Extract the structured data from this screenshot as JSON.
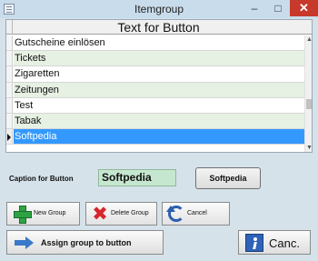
{
  "window": {
    "title": "Itemgroup",
    "minimize_glyph": "–",
    "maximize_glyph": "□",
    "close_glyph": "✕"
  },
  "grid": {
    "column_header": "Text for Button",
    "rows": [
      {
        "text": "Gutscheine einlösen"
      },
      {
        "text": "Tickets"
      },
      {
        "text": "Zigaretten"
      },
      {
        "text": "Zeitungen"
      },
      {
        "text": "Test"
      },
      {
        "text": "Tabak"
      },
      {
        "text": "Softpedia"
      }
    ],
    "selected_row_text": "Softpedia",
    "scroll_up_glyph": "▲",
    "scroll_down_glyph": "▼"
  },
  "caption": {
    "label": "Caption for Button",
    "value": "Softpedia",
    "preview_button_label": "Softpedia"
  },
  "actions": {
    "new_group": "New Group",
    "delete_group": "Delete Group",
    "cancel": "Cancel",
    "assign_group": "Assign group to button",
    "exit": "Canc."
  },
  "icons": {
    "new_group": "plus-icon",
    "delete_group": "delete-x-icon",
    "cancel": "undo-icon",
    "assign_group": "arrow-right-icon",
    "exit": "exit-door-icon"
  },
  "colors": {
    "selection": "#3399ff",
    "alt_row": "#e6f0e3",
    "caption_field": "#c6e7cf",
    "close_button": "#c7392a"
  }
}
